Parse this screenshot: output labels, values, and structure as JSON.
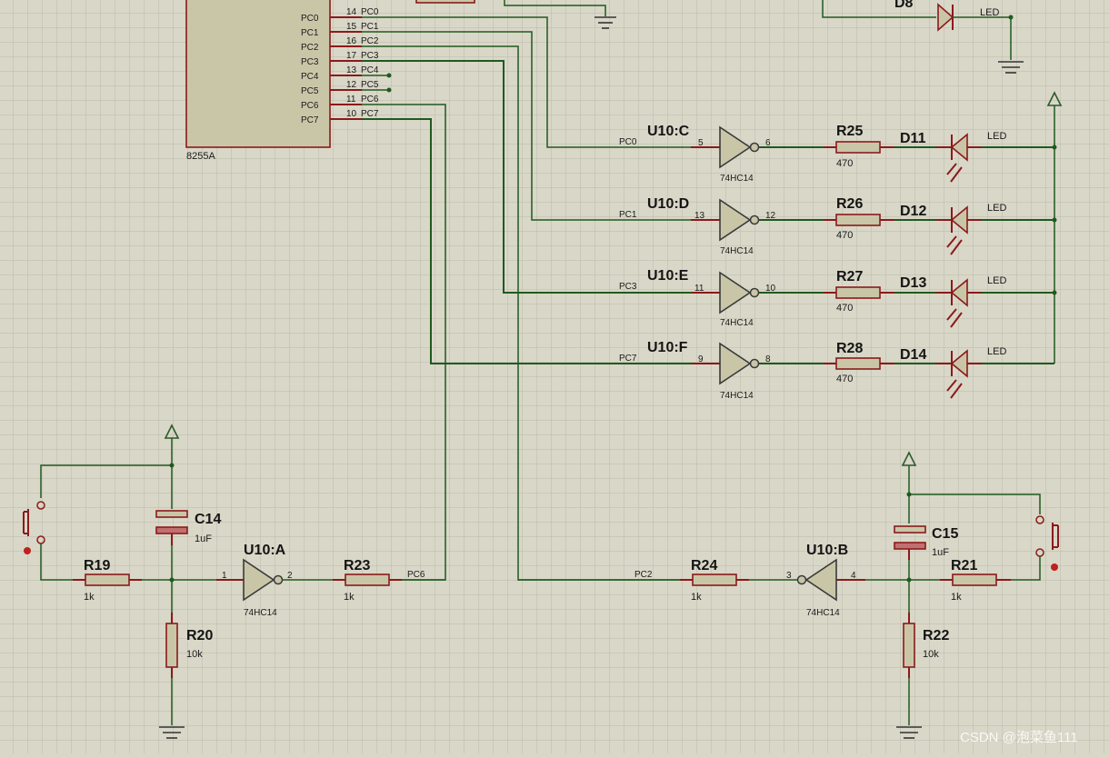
{
  "watermark": "CSDN @泡菜鱼111",
  "ic": {
    "name": "8255A",
    "pins": [
      {
        "label": "PC0",
        "num": "14",
        "net": "PC0"
      },
      {
        "label": "PC1",
        "num": "15",
        "net": "PC1"
      },
      {
        "label": "PC2",
        "num": "16",
        "net": "PC2"
      },
      {
        "label": "PC3",
        "num": "17",
        "net": "PC3"
      },
      {
        "label": "PC4",
        "num": "13",
        "net": "PC4"
      },
      {
        "label": "PC5",
        "num": "12",
        "net": "PC5"
      },
      {
        "label": "PC6",
        "num": "11",
        "net": "PC6"
      },
      {
        "label": "PC7",
        "num": "10",
        "net": "PC7"
      }
    ]
  },
  "top_partial": {
    "diode": "D8",
    "led": "LED"
  },
  "channels": [
    {
      "gate": "U10:C",
      "net": "PC0",
      "in": "5",
      "out": "6",
      "res": "R25",
      "rval": "470",
      "diode": "D11",
      "led": "LED",
      "type": "74HC14"
    },
    {
      "gate": "U10:D",
      "net": "PC1",
      "in": "13",
      "out": "12",
      "res": "R26",
      "rval": "470",
      "diode": "D12",
      "led": "LED",
      "type": "74HC14"
    },
    {
      "gate": "U10:E",
      "net": "PC3",
      "in": "11",
      "out": "10",
      "res": "R27",
      "rval": "470",
      "diode": "D13",
      "led": "LED",
      "type": "74HC14"
    },
    {
      "gate": "U10:F",
      "net": "PC7",
      "in": "9",
      "out": "8",
      "res": "R28",
      "rval": "470",
      "diode": "D14",
      "led": "LED",
      "type": "74HC14"
    }
  ],
  "left_circuit": {
    "cap": "C14",
    "cap_val": "1uF",
    "r_in": "R19",
    "r_in_val": "1k",
    "r_pull": "R20",
    "r_pull_val": "10k",
    "gate": "U10:A",
    "gate_in": "1",
    "gate_out": "2",
    "gate_type": "74HC14",
    "r_out": "R23",
    "r_out_val": "1k",
    "net": "PC6"
  },
  "right_circuit": {
    "cap": "C15",
    "cap_val": "1uF",
    "r_in": "R21",
    "r_in_val": "1k",
    "r_pull": "R22",
    "r_pull_val": "10k",
    "gate": "U10:B",
    "gate_in": "4",
    "gate_out": "3",
    "gate_type": "74HC14",
    "r_out": "R24",
    "r_out_val": "1k",
    "net": "PC2"
  }
}
